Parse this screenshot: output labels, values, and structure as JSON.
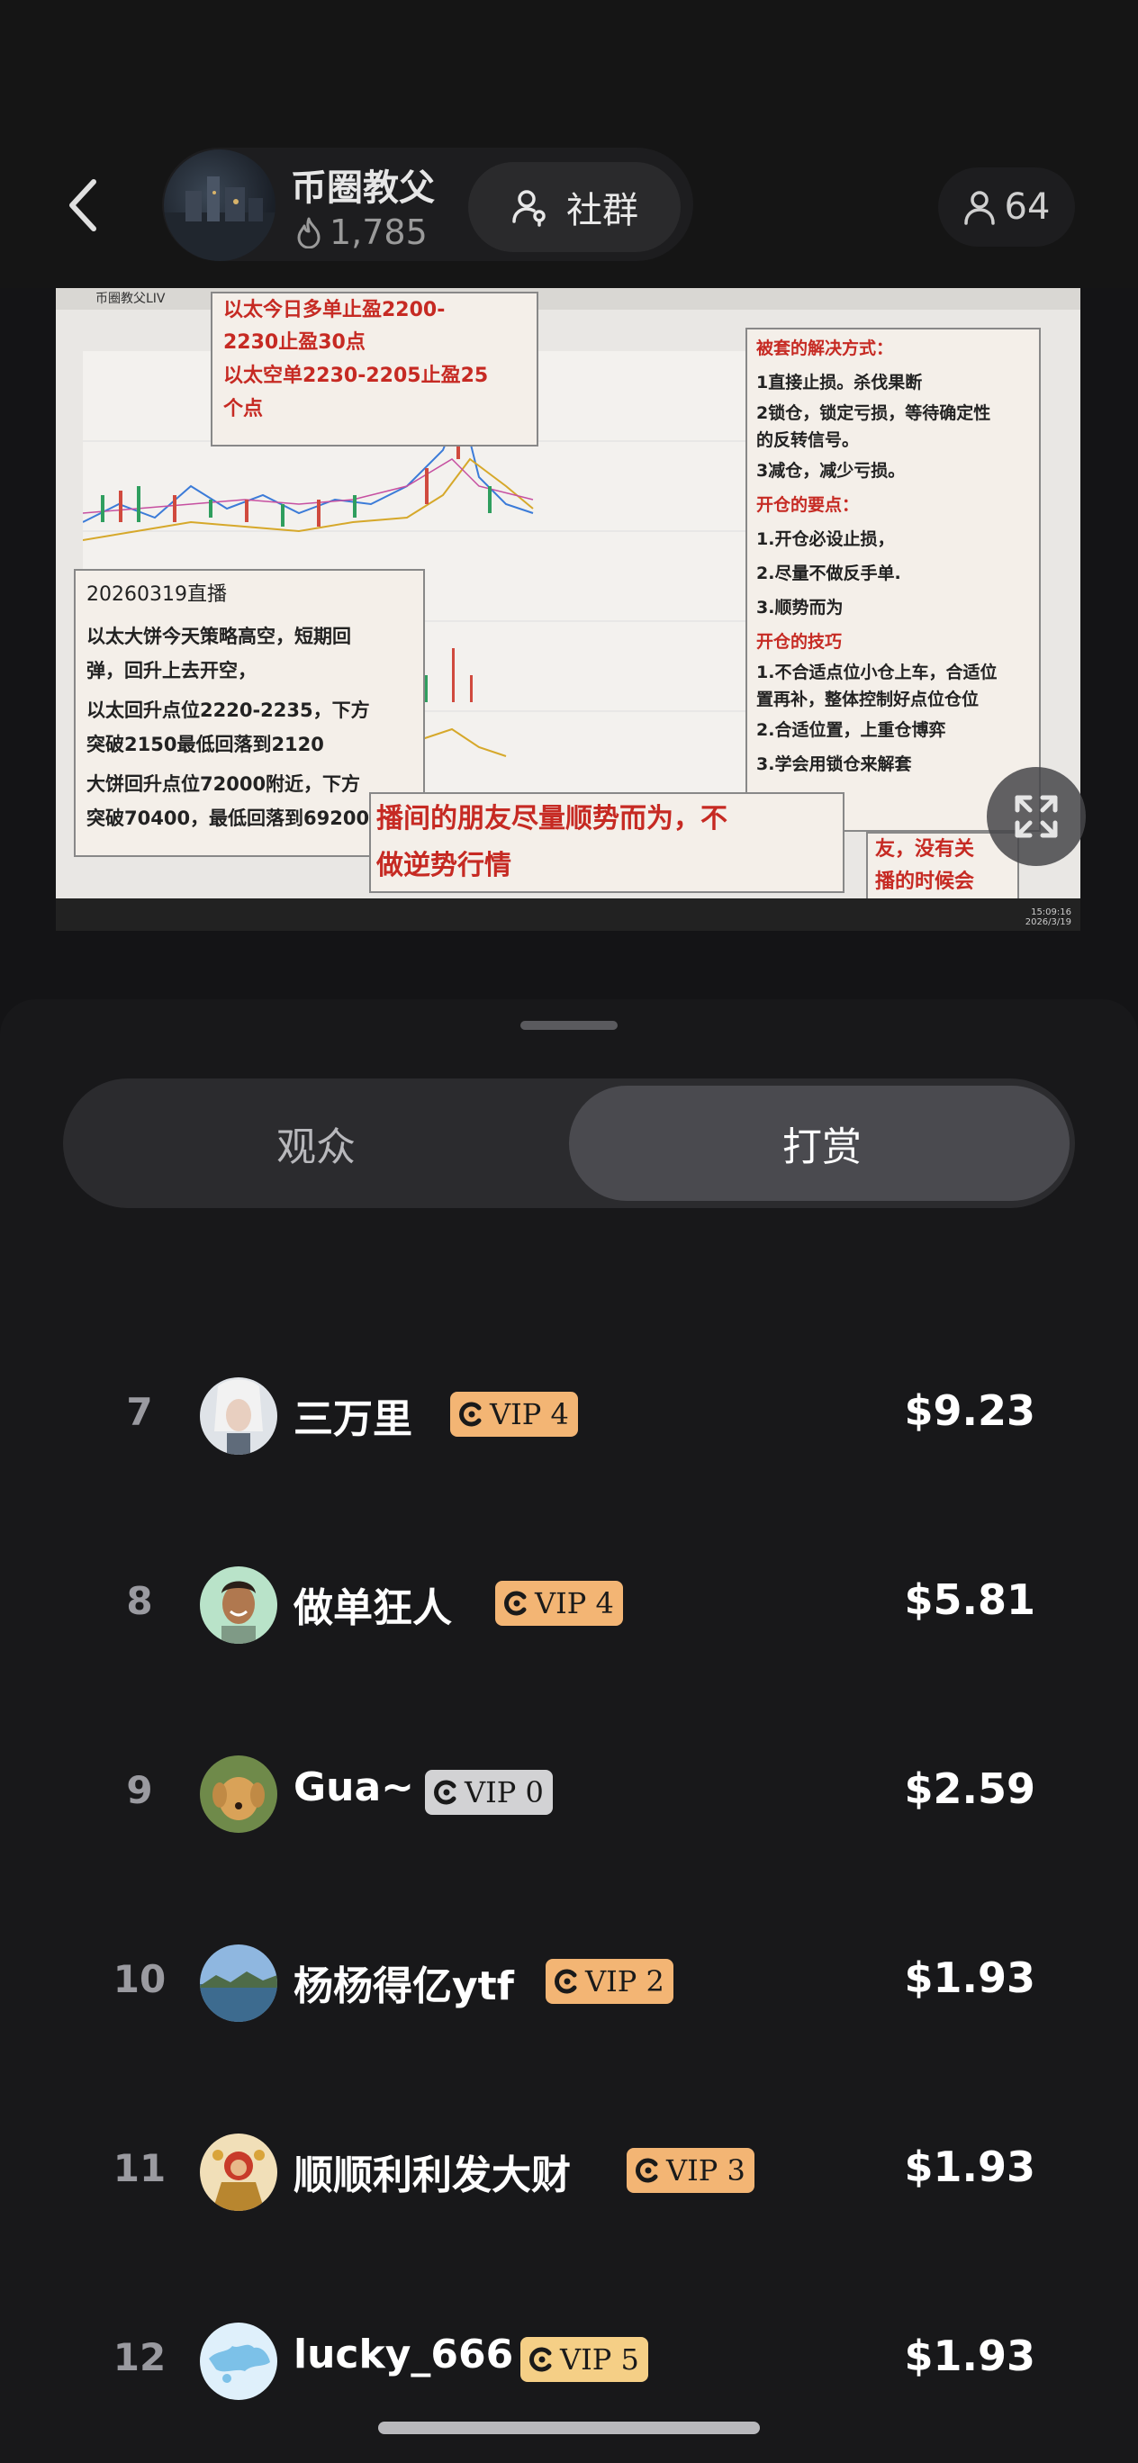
{
  "header": {
    "host_name": "币圈教父",
    "host_likes": "1,785",
    "community_label": "社群",
    "viewer_count": "64"
  },
  "stream": {
    "window_title": "币圈教父LIV",
    "timestamp": "15:09:16\n2026/3/19",
    "note_top": {
      "line1": "以太今日多单止盈2200-",
      "line2": "2230止盈30点",
      "line3": "以太空单2230-2205止盈25",
      "line4": "个点"
    },
    "note_left": {
      "title": "20260319直播",
      "p1a": "以太大饼今天策略高空，短期回",
      "p1b": "弹，回升上去开空，",
      "p2a": "以太回升点位2220-2235，下方",
      "p2b": "突破2150最低回落到2120",
      "p3a": "大饼回升点位72000附近，下方",
      "p3b": "突破70400，最低回落到69200"
    },
    "note_right": {
      "h1": "被套的解决方式：",
      "l1": "1直接止损。杀伐果断",
      "l2a": "2锁仓，锁定亏损，等待确定性",
      "l2b": "的反转信号。",
      "l3": "3减仓，减少亏损。",
      "h2": "开仓的要点：",
      "l4": "1.开仓必设止损，",
      "l5": "2.尽量不做反手单.",
      "l6": "3.顺势而为",
      "h3": "开仓的技巧",
      "l7a": "1.不合适点位小仓上车，合适位",
      "l7b": "置再补，整体控制好点位仓位",
      "l8": "2.合适位置，上重仓博弈",
      "l9": "3.学会用锁仓来解套"
    },
    "note_bottom": {
      "line1": "播间的朋友尽量顺势而为，不",
      "line2": "做逆势行情"
    },
    "note_corner": {
      "line1": "友，没有关",
      "line2": "播的时候会"
    }
  },
  "tabs": {
    "viewers": "观众",
    "tips": "打赏"
  },
  "rows": [
    {
      "rank": "7",
      "name": "三万里",
      "vip": "VIP 4",
      "amount": "$9.23",
      "vip_color": "#f3b574"
    },
    {
      "rank": "8",
      "name": "做单狂人",
      "vip": "VIP 4",
      "amount": "$5.81",
      "vip_color": "#f3b574"
    },
    {
      "rank": "9",
      "name": "Gua~",
      "vip": "VIP 0",
      "amount": "$2.59",
      "vip_color": "#d2d2d4"
    },
    {
      "rank": "10",
      "name": "杨杨得亿ytf",
      "vip": "VIP 2",
      "amount": "$1.93",
      "vip_color": "#f3b574"
    },
    {
      "rank": "11",
      "name": "顺顺利利发大财",
      "vip": "VIP 3",
      "amount": "$1.93",
      "vip_color": "#f3b574"
    },
    {
      "rank": "12",
      "name": "lucky_666",
      "vip": "VIP 5",
      "amount": "$1.93",
      "vip_color": "#f5cf86"
    }
  ]
}
